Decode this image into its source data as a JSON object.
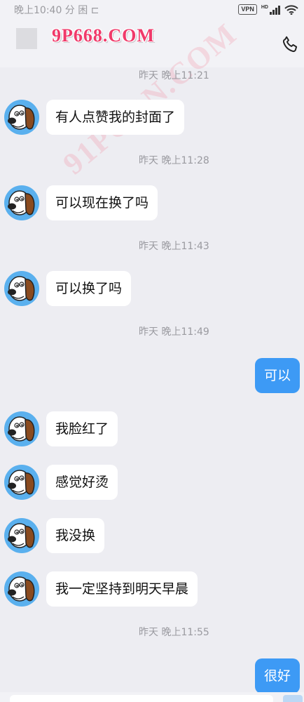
{
  "status_bar": {
    "time": "晚上10:40 分 困 ⊏",
    "vpn": "VPN",
    "network": "HD"
  },
  "header": {
    "title": "9P668.COM"
  },
  "watermark": "91PORN.COM",
  "messages": [
    {
      "timestamp": "昨天 晚上11:21"
    },
    {
      "text": "有人点赞我的封面了"
    },
    {
      "timestamp": "昨天 晚上11:28"
    },
    {
      "text": "可以现在换了吗"
    },
    {
      "timestamp": "昨天 晚上11:43"
    },
    {
      "text": "可以换了吗"
    },
    {
      "timestamp": "昨天 晚上11:49"
    },
    {
      "text": "可以"
    },
    {
      "text": "我脸红了"
    },
    {
      "text": "感觉好烫"
    },
    {
      "text": "我没换"
    },
    {
      "text": "我一定坚持到明天早晨"
    },
    {
      "timestamp": "昨天 晚上11:55"
    },
    {
      "text": "很好"
    }
  ],
  "icons": {
    "phone": "phone-icon",
    "avatar": "dog-avatar"
  },
  "colors": {
    "outgoing_bubble": "#3d9af5",
    "incoming_bubble": "#ffffff",
    "background": "#ededf2",
    "title": "#f03a6a"
  }
}
